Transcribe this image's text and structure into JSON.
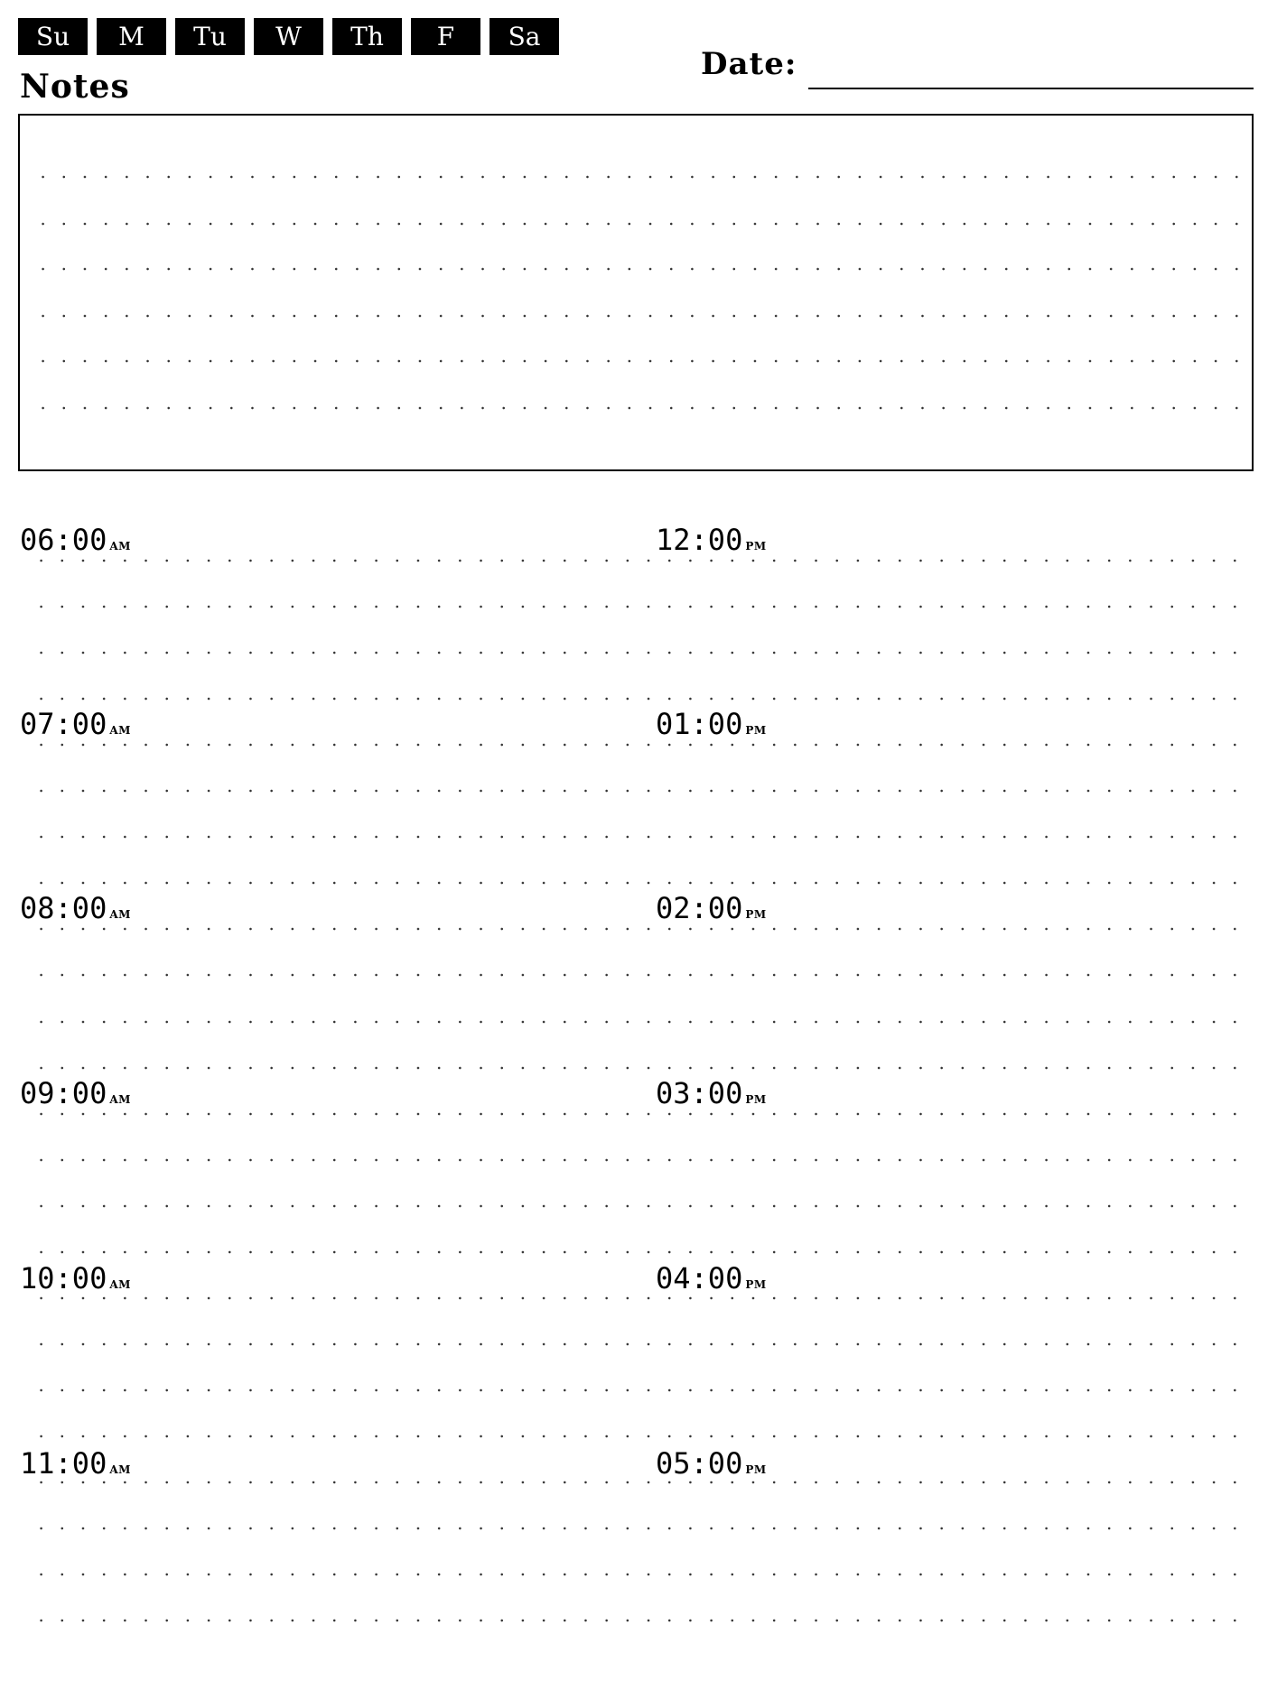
{
  "days": [
    "Su",
    "M",
    "Tu",
    "W",
    "Th",
    "F",
    "Sa"
  ],
  "notes_title": "Notes",
  "date_label": "Date:",
  "schedule": {
    "left": [
      {
        "time": "06:00",
        "period": "AM"
      },
      {
        "time": "07:00",
        "period": "AM"
      },
      {
        "time": "08:00",
        "period": "AM"
      },
      {
        "time": "09:00",
        "period": "AM"
      },
      {
        "time": "10:00",
        "period": "AM"
      },
      {
        "time": "11:00",
        "period": "AM"
      }
    ],
    "right": [
      {
        "time": "12:00",
        "period": "PM"
      },
      {
        "time": "01:00",
        "period": "PM"
      },
      {
        "time": "02:00",
        "period": "PM"
      },
      {
        "time": "03:00",
        "period": "PM"
      },
      {
        "time": "04:00",
        "period": "PM"
      },
      {
        "time": "05:00",
        "period": "PM"
      }
    ]
  }
}
